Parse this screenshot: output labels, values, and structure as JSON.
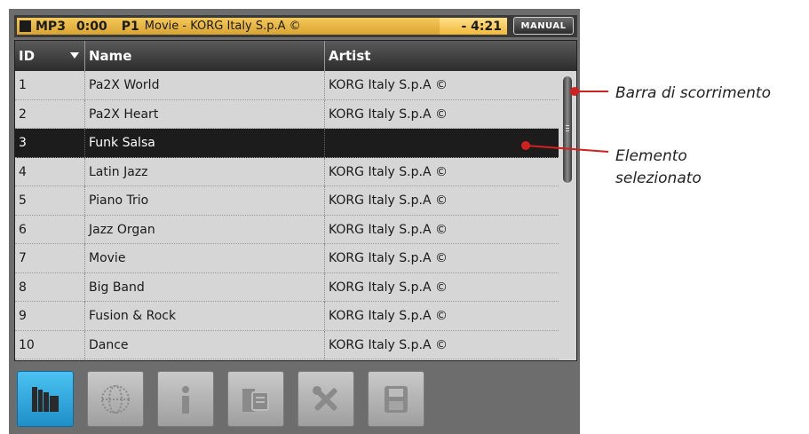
{
  "status_bar": {
    "format": "MP3",
    "elapsed": "0:00",
    "pad": "P1",
    "song": "Movie - KORG Italy S.p.A ©",
    "remaining": "- 4:21",
    "manual_label": "MANUAL"
  },
  "list": {
    "columns": {
      "id": "ID",
      "name": "Name",
      "artist": "Artist"
    },
    "rows": [
      {
        "id": "1",
        "name": "Pa2X World",
        "artist": "KORG Italy S.p.A ©"
      },
      {
        "id": "2",
        "name": "Pa2X Heart",
        "artist": "KORG Italy S.p.A ©"
      },
      {
        "id": "3",
        "name": "Funk Salsa",
        "artist": ""
      },
      {
        "id": "4",
        "name": "Latin Jazz",
        "artist": "KORG Italy S.p.A ©"
      },
      {
        "id": "5",
        "name": "Piano Trio",
        "artist": "KORG Italy S.p.A ©"
      },
      {
        "id": "6",
        "name": "Jazz Organ",
        "artist": "KORG Italy S.p.A ©"
      },
      {
        "id": "7",
        "name": "Movie",
        "artist": "KORG Italy S.p.A ©"
      },
      {
        "id": "8",
        "name": "Big Band",
        "artist": "KORG Italy S.p.A ©"
      },
      {
        "id": "9",
        "name": "Fusion & Rock",
        "artist": "KORG Italy S.p.A ©"
      },
      {
        "id": "10",
        "name": "Dance",
        "artist": "KORG Italy S.p.A ©"
      }
    ],
    "selected_id": "3"
  },
  "toolbar": {
    "buttons": [
      {
        "icon": "library-icon",
        "active": true
      },
      {
        "icon": "globe-icon",
        "active": false
      },
      {
        "icon": "info-icon",
        "active": false
      },
      {
        "icon": "songbook-edit-icon",
        "active": false
      },
      {
        "icon": "tools-icon",
        "active": false
      },
      {
        "icon": "save-icon",
        "active": false
      }
    ]
  },
  "callouts": {
    "scrollbar": "Barra di scorrimento",
    "selected_line1": "Elemento",
    "selected_line2": "selezionato"
  },
  "colors": {
    "status_bar": "#e0ad3a",
    "selected_row": "#1c1c1c",
    "active_tool": "#2ea3dd",
    "callout_line": "#d02020"
  }
}
